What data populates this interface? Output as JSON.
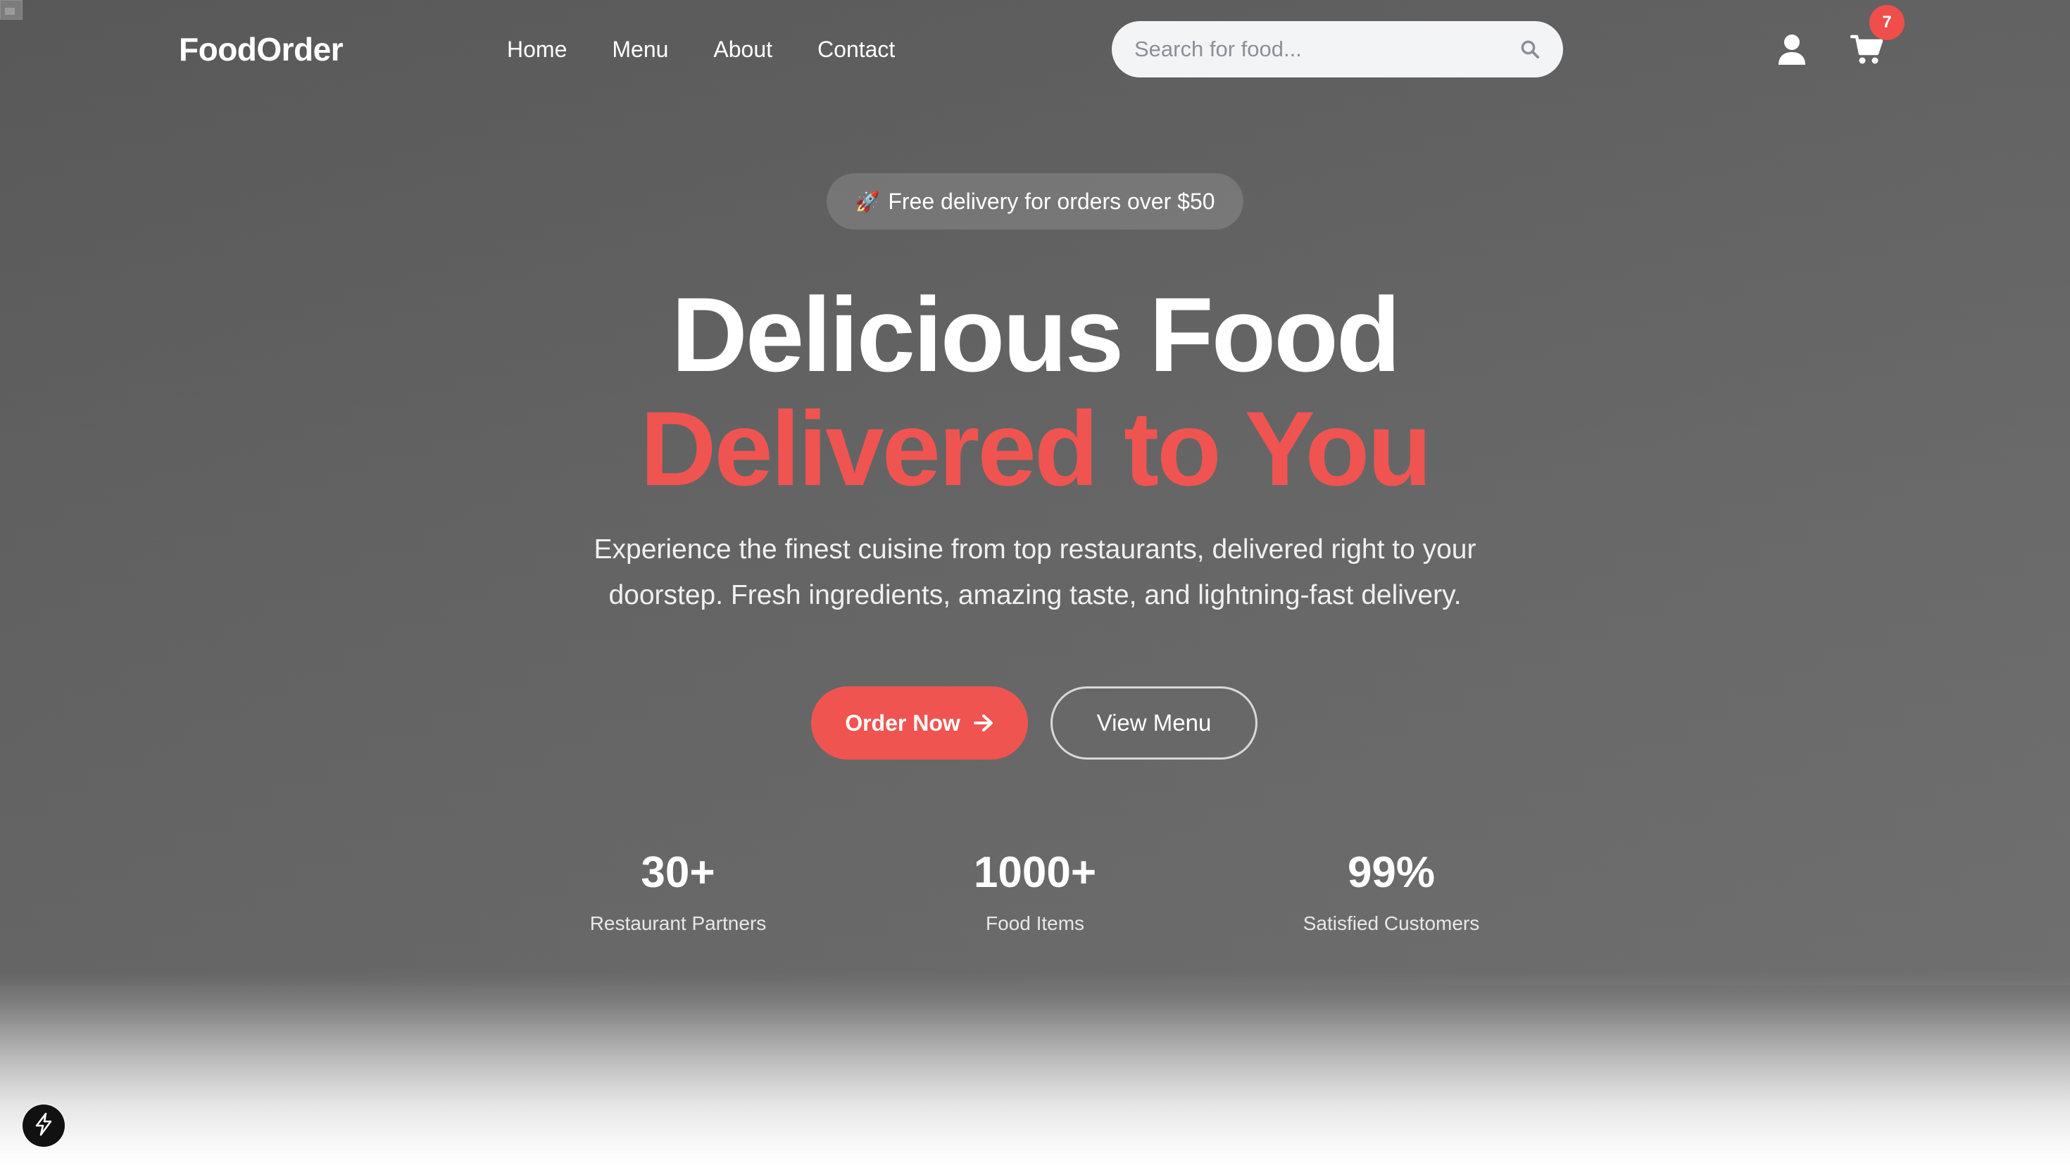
{
  "nav": {
    "logo": "FoodOrder",
    "links": [
      "Home",
      "Menu",
      "About",
      "Contact"
    ],
    "search_placeholder": "Search for food...",
    "cart_count": "7"
  },
  "hero": {
    "promo_icon": "🚀",
    "promo_text": "Free delivery for orders over $50",
    "headline_line1": "Delicious Food",
    "headline_line2": "Delivered to You",
    "subtext": "Experience the finest cuisine from top restaurants, delivered right to your doorstep. Fresh ingredients, amazing taste, and lightning-fast delivery.",
    "primary_button": "Order Now",
    "secondary_button": "View Menu"
  },
  "stats": [
    {
      "value": "30+",
      "label": "Restaurant Partners"
    },
    {
      "value": "1000+",
      "label": "Food Items"
    },
    {
      "value": "99%",
      "label": "Satisfied Customers"
    }
  ],
  "icons": {
    "search": "search-icon",
    "user": "user-icon",
    "cart": "cart-icon",
    "arrow": "arrow-right-icon",
    "dev": "lightning-icon"
  },
  "colors": {
    "accent": "#ef5451",
    "badge": "#ef4e4b",
    "search_bg": "#f3f4f6"
  }
}
